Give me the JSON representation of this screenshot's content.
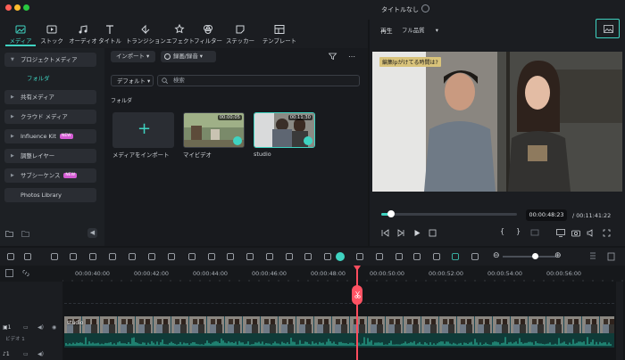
{
  "window": {
    "title": "タイトルなし"
  },
  "toolbar": {
    "tabs": [
      {
        "label": "メディア",
        "icon": "media-icon"
      },
      {
        "label": "ストック",
        "icon": "stock-icon"
      },
      {
        "label": "オーディオ",
        "icon": "audio-icon"
      },
      {
        "label": "タイトル",
        "icon": "title-icon"
      },
      {
        "label": "トランジション",
        "icon": "transition-icon"
      },
      {
        "label": "エフェクト",
        "icon": "effect-icon"
      },
      {
        "label": "フィルター",
        "icon": "filter-icon"
      },
      {
        "label": "ステッカー",
        "icon": "sticker-icon"
      },
      {
        "label": "テンプレート",
        "icon": "template-icon"
      }
    ]
  },
  "sidebar": {
    "items": [
      {
        "label": "プロジェクトメディア"
      },
      {
        "label": "フォルダ"
      },
      {
        "label": "共有メディア"
      },
      {
        "label": "クラウド メディア"
      },
      {
        "label": "Influence Kit",
        "badge": "NEW"
      },
      {
        "label": "調整レイヤー"
      },
      {
        "label": "サブシーケンス",
        "badge": "NEW"
      },
      {
        "label": "Photos Library"
      }
    ]
  },
  "media": {
    "import_label": "インポート",
    "record_label": "録画/録音",
    "sort_label": "デフォルト",
    "search_placeholder": "検索",
    "folder_label": "フォルダ",
    "items": [
      {
        "caption": "メディアをインポート"
      },
      {
        "caption": "マイビデオ",
        "duration": "00:00:05"
      },
      {
        "caption": "studio",
        "duration": "00:11:30"
      }
    ]
  },
  "player": {
    "mode_label": "再生",
    "quality": "フル品質",
    "caption": "編集lpがけてる時間は?",
    "current_time": "00:00:48:23",
    "total_time": "00:11:41:22",
    "progress": 0.07
  },
  "timeline": {
    "ticks": [
      "00:00:40:00",
      "00:00:42:00",
      "00:00:44:00",
      "00:00:46:00",
      "00:00:48:00",
      "00:00:50:00",
      "00:00:52:00",
      "00:00:54:00",
      "00:00:56:00"
    ],
    "clip_label": "studio",
    "track_label": "ビデオ 1",
    "zoom": 0.6
  },
  "colors": {
    "accent": "#3fd3c1",
    "playhead": "#ff4d5e"
  }
}
